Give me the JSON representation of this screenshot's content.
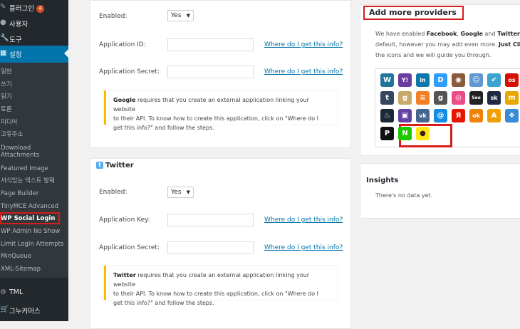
{
  "sidebar": {
    "plugins_label": "플러그인",
    "plugins_count": "4",
    "users_label": "사용자",
    "tools_label": "도구",
    "settings_label": "설정",
    "tml_label": "TML",
    "woocommerce_label": "그누커머스",
    "submenu": [
      "일반",
      "쓰기",
      "읽기",
      "토론",
      "미디어",
      "고유주소",
      "Download",
      "Attachments",
      "Featured Image",
      "서식있는 텍스트 발췌",
      "Page Builder",
      "TinyMCE Advanced",
      "WP Social Login",
      "WP Admin No Show",
      "Limit Login Attempts",
      "MinQueue",
      "XML-Sitemap"
    ]
  },
  "google_panel": {
    "enabled_label": "Enabled:",
    "enabled_value": "Yes",
    "app_id_label": "Application ID:",
    "app_secret_label": "Application Secret:",
    "help_link_1": "Where do I get this info?",
    "help_link_2": "Where do I get this info?",
    "note_provider": "Google",
    "note_line1": " requires that you create an external application linking your website",
    "note_line2": "to their API. To know how to create this application, click on \"Where do I",
    "note_line3": "get this info?\" and follow the steps."
  },
  "twitter_panel": {
    "title": "Twitter",
    "enabled_label": "Enabled:",
    "enabled_value": "Yes",
    "app_key_label": "Application Key:",
    "app_secret_label": "Application Secret:",
    "help_link_1": "Where do I get this info?",
    "help_link_2": "Where do I get this info?",
    "note_provider": "Twitter",
    "note_line1": " requires that you create an external application linking your website",
    "note_line2": "to their API. To know how to create this application, click on \"Where do I",
    "note_line3": "get this info?\" and follow the steps."
  },
  "providers_panel": {
    "title": "Add more providers",
    "desc1_a": "We have enabled ",
    "desc1_b": "Facebook",
    "desc1_c": ", ",
    "desc1_d": "Google",
    "desc1_e": " and ",
    "desc1_f": "Twitter",
    "desc1_g": " b",
    "desc2_a": "default, however you may add even more. ",
    "desc2_b": "Just Cli",
    "desc3": "the icons and we will guide you through.",
    "icons": [
      {
        "name": "wordpress",
        "glyph": "W",
        "color": "#21759b"
      },
      {
        "name": "yahoo",
        "glyph": "Y!",
        "color": "#6a3ea1"
      },
      {
        "name": "linkedin",
        "glyph": "in",
        "color": "#0e76a8"
      },
      {
        "name": "disqus",
        "glyph": "D",
        "color": "#2e9fff"
      },
      {
        "name": "instagram",
        "glyph": "◉",
        "color": "#8a5a3c"
      },
      {
        "name": "reddit",
        "glyph": "☺",
        "color": "#5f99cf"
      },
      {
        "name": "foursquare",
        "glyph": "✔",
        "color": "#3ba3d0"
      },
      {
        "name": "lastfm",
        "glyph": "os",
        "color": "#d51007"
      },
      {
        "name": "tumblr",
        "glyph": "t",
        "color": "#36465d"
      },
      {
        "name": "goodreads",
        "glyph": "g",
        "color": "#c8a96a"
      },
      {
        "name": "stackoverflow",
        "glyph": "≡",
        "color": "#f48024"
      },
      {
        "name": "goodgame",
        "glyph": "g",
        "color": "#555555"
      },
      {
        "name": "dribbble",
        "glyph": "◎",
        "color": "#ea4c89"
      },
      {
        "name": "500px",
        "glyph": "5oo",
        "color": "#222222"
      },
      {
        "name": "skyrock",
        "glyph": "sk",
        "color": "#1e2a44"
      },
      {
        "name": "mixi",
        "glyph": "m",
        "color": "#e6a800"
      },
      {
        "name": "steam",
        "glyph": "♨",
        "color": "#1b2838"
      },
      {
        "name": "twitch",
        "glyph": "▣",
        "color": "#6441a5"
      },
      {
        "name": "vkontakte",
        "glyph": "vk",
        "color": "#45668e"
      },
      {
        "name": "mailru",
        "glyph": "@",
        "color": "#168de2"
      },
      {
        "name": "yandex",
        "glyph": "Я",
        "color": "#e61400"
      },
      {
        "name": "odnoklassniki",
        "glyph": "ok",
        "color": "#ee8208"
      },
      {
        "name": "aol",
        "glyph": "A",
        "color": "#f0a000"
      },
      {
        "name": "live",
        "glyph": "❖",
        "color": "#3a8ad6"
      },
      {
        "name": "pixelpin",
        "glyph": "P",
        "color": "#111111"
      },
      {
        "name": "naver",
        "glyph": "N",
        "color": "#1ec800"
      },
      {
        "name": "kakao",
        "glyph": "●",
        "color": "#ffe812"
      }
    ]
  },
  "insights_panel": {
    "title": "Insights",
    "text": "There's no data yet."
  }
}
